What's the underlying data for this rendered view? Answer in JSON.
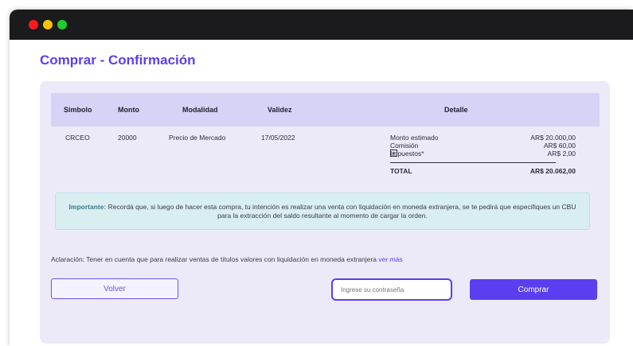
{
  "page": {
    "title": "Comprar - Confirmación"
  },
  "colors": {
    "accent": "#5b3ef0",
    "dot_red": "#ff1b1b",
    "dot_yellow": "#ffc400",
    "dot_green": "#1fce2a"
  },
  "table": {
    "headers": [
      "Simbolo",
      "Monto",
      "Modalidad",
      "Validez",
      "Detalle"
    ],
    "row": {
      "simbolo": "CRCEO",
      "monto": "20000",
      "modalidad": "Precio de Mercado",
      "validez": "17/05/2022"
    },
    "detail": {
      "items": [
        {
          "label": "Monto estimado",
          "value": "AR$ 20.000,00"
        },
        {
          "label": "Comisión",
          "value": "AR$ 60,00"
        },
        {
          "label": "Impuestos*",
          "value": "AR$ 2,00"
        }
      ],
      "total_label": "TOTAL",
      "total_value": "AR$ 20.062,00"
    }
  },
  "notice": {
    "title": "Importante:",
    "text": "Recordá que, si luego de hacer esta compra, tu intención es realizar una venta con liquidación en moneda extranjera, se te pedirá que especifiques un CBU para la extracción del saldo resultante al momento de cargar la orden."
  },
  "aclaracion": {
    "text": "Aclaración: Tener en cuenta que para realizar ventas de títulos valores con liquidación en moneda extranjera",
    "link": "ver más"
  },
  "actions": {
    "volver_label": "Volver",
    "password_placeholder": "Ingrese su contraseña",
    "comprar_label": "Comprar"
  }
}
